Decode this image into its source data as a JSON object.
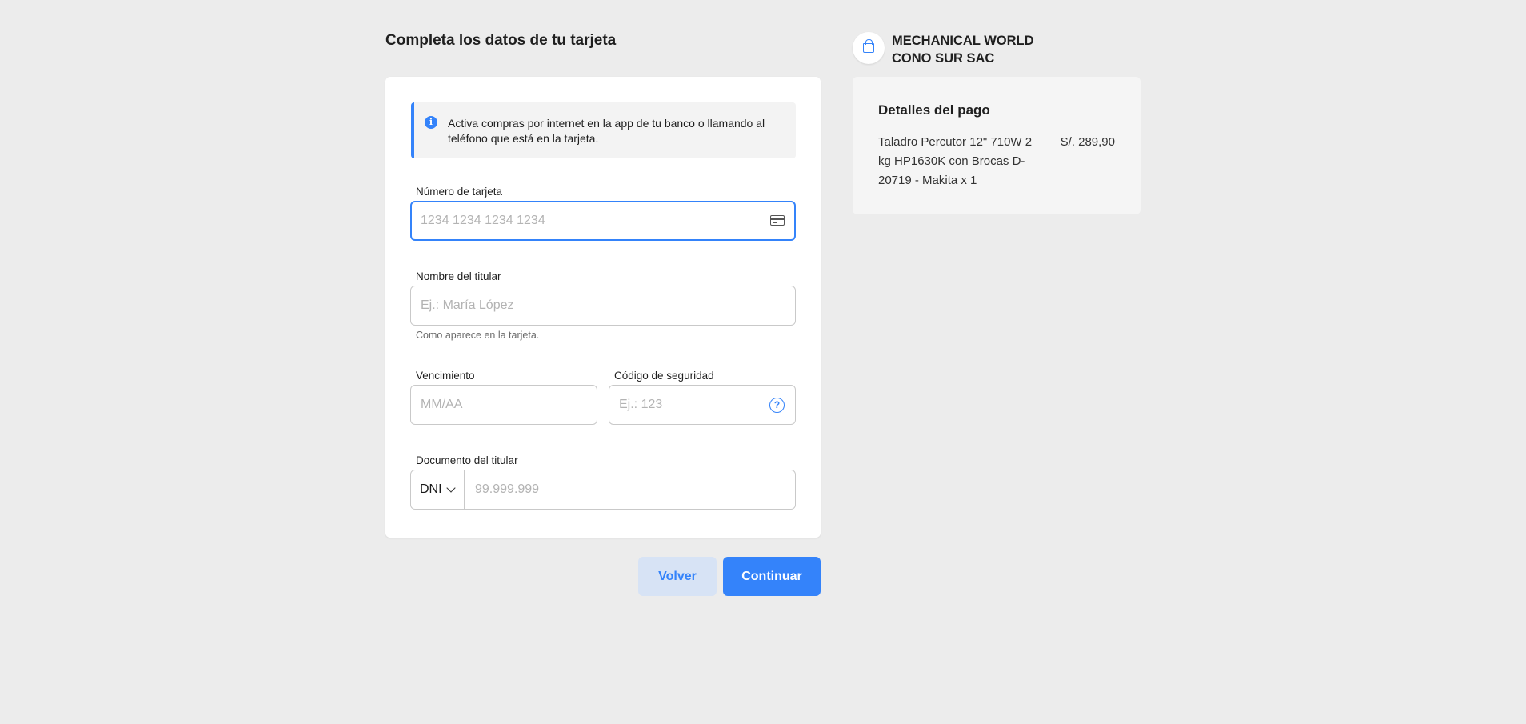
{
  "page": {
    "title": "Completa los datos de tu tarjeta"
  },
  "info_banner": {
    "text": "Activa compras por internet en la app de tu banco o llamando al teléfono que está en la tarjeta."
  },
  "form": {
    "card_number": {
      "label": "Número de tarjeta",
      "placeholder": "1234 1234 1234 1234",
      "value": ""
    },
    "holder_name": {
      "label": "Nombre del titular",
      "placeholder": "Ej.: María López",
      "value": "",
      "helper": "Como aparece en la tarjeta."
    },
    "expiry": {
      "label": "Vencimiento",
      "placeholder": "MM/AA",
      "value": ""
    },
    "security_code": {
      "label": "Código de seguridad",
      "placeholder": "Ej.: 123",
      "value": "",
      "help_glyph": "?"
    },
    "document": {
      "label": "Documento del titular",
      "type_selected": "DNI",
      "placeholder": "99.999.999",
      "value": ""
    }
  },
  "actions": {
    "back_label": "Volver",
    "continue_label": "Continuar"
  },
  "merchant": {
    "name": "MECHANICAL WORLD CONO SUR SAC",
    "logo_icon": "shopping-bag-icon"
  },
  "summary": {
    "title": "Detalles del pago",
    "items": [
      {
        "description": "Taladro Percutor 12\" 710W 2 kg HP1630K con Brocas D-20719 - Makita x 1",
        "price": "S/. 289,90"
      }
    ]
  },
  "colors": {
    "accent": "#3483fa",
    "background": "#ececec",
    "card": "#ffffff",
    "summary_card": "#f5f5f5",
    "back_button_bg": "#d7e3f5"
  }
}
